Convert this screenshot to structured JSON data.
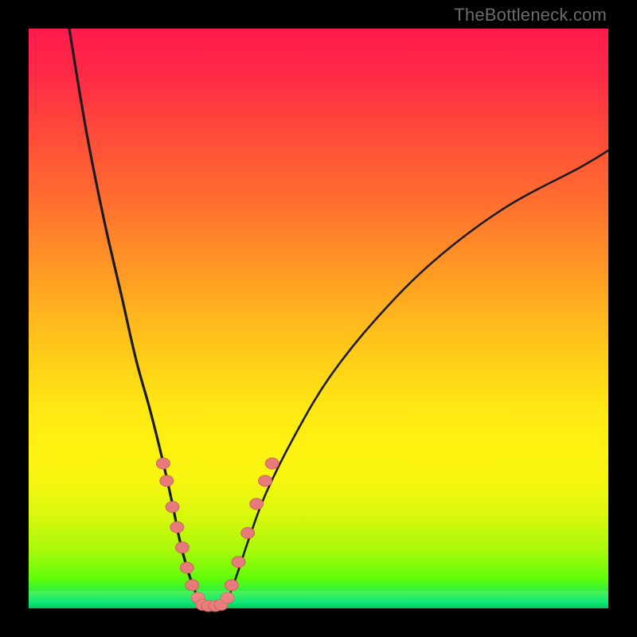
{
  "watermark": "TheBottleneck.com",
  "chart_data": {
    "type": "line",
    "title": "",
    "xlabel": "",
    "ylabel": "",
    "xlim": [
      0,
      100
    ],
    "ylim": [
      0,
      100
    ],
    "series": [
      {
        "name": "left-curve",
        "x": [
          7,
          10,
          13,
          16,
          18.5,
          21,
          23,
          24.8,
          26,
          27.3,
          28.5,
          29.5,
          30.5
        ],
        "y": [
          100,
          82,
          67,
          54,
          43,
          34,
          26,
          18,
          12,
          7,
          3.5,
          1.2,
          0.5
        ]
      },
      {
        "name": "right-curve",
        "x": [
          33.5,
          34.5,
          36,
          38,
          41,
          46,
          52,
          60,
          70,
          82,
          95,
          100
        ],
        "y": [
          0.5,
          2,
          6,
          12,
          20,
          30,
          40,
          50,
          60,
          69,
          76,
          79
        ]
      },
      {
        "name": "valley-floor",
        "x": [
          30.5,
          31.5,
          32.5,
          33.5
        ],
        "y": [
          0.5,
          0.3,
          0.3,
          0.5
        ]
      }
    ],
    "markers": [
      {
        "series": "left-curve",
        "points": [
          {
            "x": 23.2,
            "y": 25
          },
          {
            "x": 23.8,
            "y": 22
          },
          {
            "x": 24.8,
            "y": 17.5
          },
          {
            "x": 25.6,
            "y": 14
          },
          {
            "x": 26.5,
            "y": 10.5
          },
          {
            "x": 27.3,
            "y": 7
          },
          {
            "x": 28.2,
            "y": 4
          },
          {
            "x": 29.2,
            "y": 1.8
          }
        ]
      },
      {
        "series": "valley-floor",
        "points": [
          {
            "x": 30.0,
            "y": 0.6
          },
          {
            "x": 31.0,
            "y": 0.4
          },
          {
            "x": 32.2,
            "y": 0.4
          },
          {
            "x": 33.2,
            "y": 0.6
          }
        ]
      },
      {
        "series": "right-curve",
        "points": [
          {
            "x": 34.3,
            "y": 1.8
          },
          {
            "x": 35.0,
            "y": 4
          },
          {
            "x": 36.2,
            "y": 8
          },
          {
            "x": 37.8,
            "y": 13
          },
          {
            "x": 39.3,
            "y": 18
          },
          {
            "x": 40.8,
            "y": 22
          },
          {
            "x": 42.0,
            "y": 25
          }
        ]
      }
    ],
    "colors": {
      "curve": "#1b1b1b",
      "marker_fill": "#e77a7a",
      "marker_stroke": "#c85a5a",
      "background_top": "#ff1a4d",
      "background_bottom": "#00c853"
    }
  }
}
